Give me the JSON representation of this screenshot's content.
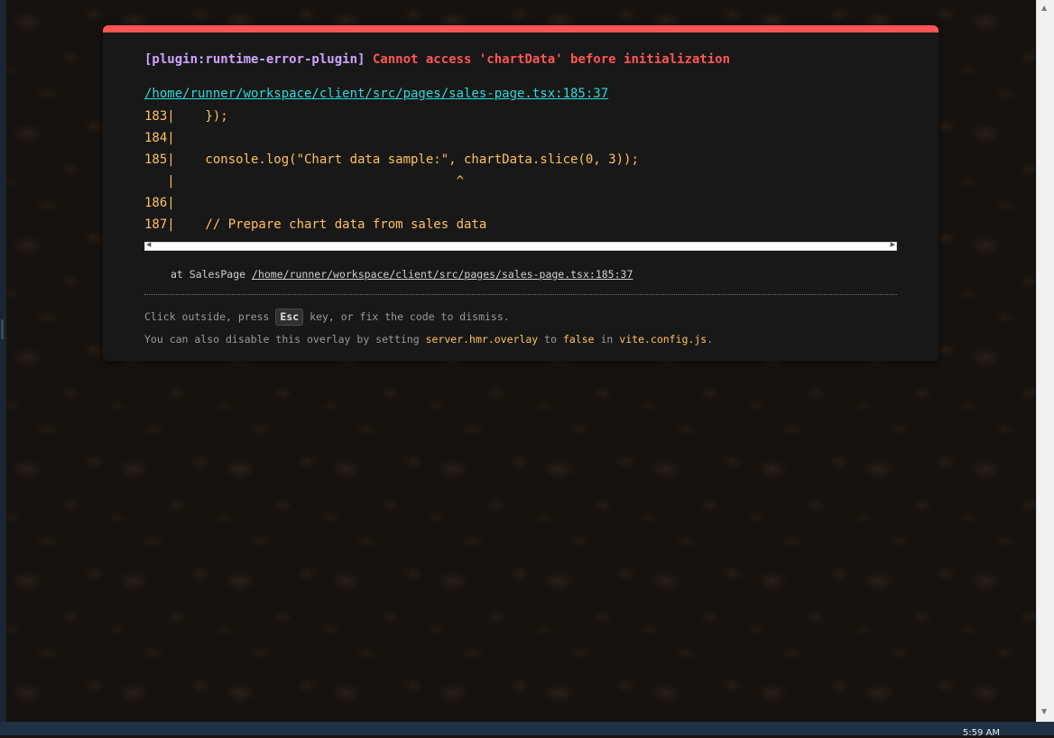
{
  "overlay": {
    "plugin": "[plugin:runtime-error-plugin]",
    "message": "Cannot access 'chartData' before initialization",
    "file": "/home/runner/workspace/client/src/pages/sales-page.tsx:185:37",
    "code_lines": [
      "183|    });",
      "184|",
      "185|    console.log(\"Chart data sample:\", chartData.slice(0, 3));",
      "   |                                     ^",
      "186|",
      "187|    // Prepare chart data from sales data"
    ],
    "stack_prefix": "at SalesPage",
    "stack_link": "/home/runner/workspace/client/src/pages/sales-page.tsx:185:37",
    "tip": {
      "click_outside": "Click outside, press",
      "esc_key": "Esc",
      "key_rest": "key, or fix the code to dismiss.",
      "disable_prefix": "You can also disable this overlay by setting",
      "hmr_option": "server.hmr.overlay",
      "to_word": "to",
      "false_value": "false",
      "in_word": "in",
      "config_file": "vite.config.js",
      "period": "."
    }
  },
  "taskbar": {
    "clock": "5:59 AM"
  },
  "icons": {
    "scroll_up": "triangle-up-icon",
    "scroll_down": "triangle-down-icon",
    "hscroll_left": "triangle-left-icon",
    "hscroll_right": "triangle-right-icon"
  },
  "colors": {
    "accent_error": "#ff5555",
    "plugin": "#cfa4ff",
    "link": "#2dd9da",
    "code": "#ffc15e",
    "overlay_bg": "#181818"
  }
}
